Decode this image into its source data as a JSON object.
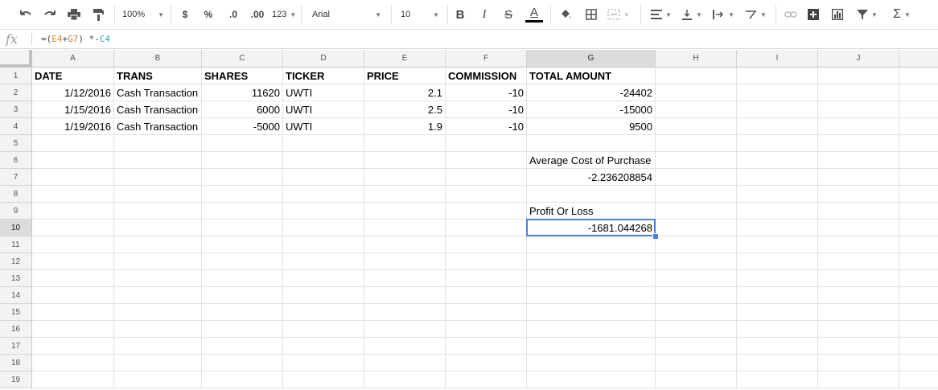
{
  "toolbar": {
    "zoom": "100%",
    "currency": "$",
    "percent": "%",
    "decrease_decimal": ".0",
    "increase_decimal": ".00",
    "more_formats": "123",
    "font": "Arial",
    "font_size": "10",
    "bold": "B",
    "italic": "I",
    "strike": "S",
    "text_color": "A",
    "sum": "Σ"
  },
  "formula_bar": {
    "fx": "fx",
    "prefix": "=(",
    "ref_e4": "E4",
    "plus": "+",
    "ref_g7": "G7",
    "mid": ") *-",
    "ref_c4": "C4"
  },
  "columns": [
    "A",
    "B",
    "C",
    "D",
    "E",
    "F",
    "G",
    "H",
    "I",
    "J"
  ],
  "rows": [
    "1",
    "2",
    "3",
    "4",
    "5",
    "6",
    "7",
    "8",
    "9",
    "10",
    "11",
    "12",
    "13",
    "14",
    "15",
    "16",
    "17",
    "18",
    "19"
  ],
  "cells": {
    "A1": "DATE",
    "B1": "TRANS",
    "C1": "SHARES",
    "D1": "TICKER",
    "E1": "PRICE",
    "F1": "COMMISSION",
    "G1": "TOTAL AMOUNT",
    "A2": "1/12/2016",
    "B2": "Cash Transaction",
    "C2": "11620",
    "D2": "UWTI",
    "E2": "2.1",
    "F2": "-10",
    "G2": "-24402",
    "A3": "1/15/2016",
    "B3": "Cash Transaction",
    "C3": "6000",
    "D3": "UWTI",
    "E3": "2.5",
    "F3": "-10",
    "G3": "-15000",
    "A4": "1/19/2016",
    "B4": "Cash Transaction",
    "C4": "-5000",
    "D4": "UWTI",
    "E4": "1.9",
    "F4": "-10",
    "G4": "9500",
    "G6": "Average Cost of Purchase",
    "G7": "-2.236208854",
    "G9": "Profit Or Loss",
    "G10": "-1681.044268"
  }
}
